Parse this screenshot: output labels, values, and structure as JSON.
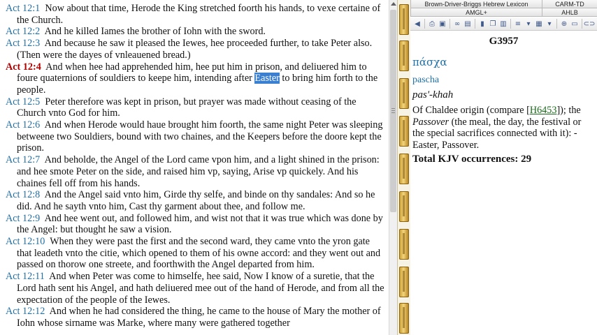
{
  "verses": [
    {
      "ref": "",
      "text": "Now about that time, Herode the King stretched foorth his hands, to vexe certaine of the Church."
    },
    {
      "ref": "Act 12:2",
      "text": "And he killed Iames the brother of Iohn with the sword."
    },
    {
      "ref": "Act 12:3",
      "text": "And because he saw it pleased the Iewes, hee proceeded further, to take Peter also. (Then were the dayes of vnleauened bread.)"
    },
    {
      "ref": "Act 12:4",
      "current": true,
      "text_before": "And when hee had apprehended him, hee put him in prison, and deliuered him to foure quaternions of souldiers to keepe him, intending after",
      "highlight": "Easter",
      "text_after": "to bring him forth to the people."
    },
    {
      "ref": "Act 12:5",
      "text": "Peter therefore was kept in prison, but prayer was made without ceasing of the Church vnto God for him."
    },
    {
      "ref": "Act 12:6",
      "text": "And when Herode would haue brought him foorth, the same night Peter was sleeping betweene two Souldiers, bound with two chaines, and the Keepers before the doore kept the prison."
    },
    {
      "ref": "Act 12:7",
      "text": "And beholde, the Angel of the Lord came vpon him, and a light shined in the prison: and hee smote Peter on the side, and raised him vp, saying, Arise vp quickely. And his chaines fell off from his hands."
    },
    {
      "ref": "Act 12:8",
      "text": "And the Angel said vnto him, Girde thy selfe, and binde on thy sandales: And so he did. And he sayth vnto him, Cast thy garment about thee, and follow me."
    },
    {
      "ref": "Act 12:9",
      "text": "And hee went out, and followed him, and wist not that it was true which was done by the Angel: but thought he saw a vision."
    },
    {
      "ref": "Act 12:10",
      "text": "When they were past the first and the second ward, they came vnto the yron gate that leadeth vnto the citie, which opened to them of his owne accord: and they went out and passed on thorow one streete, and foorthwith the Angel departed from him."
    },
    {
      "ref": "Act 12:11",
      "text": "And when Peter was come to himselfe, hee said, Now I know of a suretie, that the Lord hath sent his Angel, and hath deliuered mee out of the hand of Herode, and from all the expectation of the people of the Iewes."
    },
    {
      "ref": "Act 12:12",
      "text": "And when he had considered the thing, he came to the house of Mary the mother of Iohn whose sirname was Marke, where many were gathered together"
    }
  ],
  "first_ref": "Act 12:1",
  "lexicon": {
    "tabs_row1": [
      "Brown-Driver-Briggs Hebrew Lexicon",
      "CARM-TD"
    ],
    "tabs_row2": [
      "AMGL+",
      "AHLB"
    ],
    "strong_number": "G3957",
    "greek": "πάσχα",
    "transliteration": "pascha",
    "pronunciation": "pas'-khah",
    "def_prefix": "Of Chaldee origin (compare [",
    "def_link": "H6453",
    "def_mid": "]); the ",
    "def_italic": "Passover",
    "def_suffix": " (the meal, the day, the festival or the special sacrifices connected with it): - Easter, Passover.",
    "total_label": "Total KJV occurrences: 29"
  },
  "toolbar_icons": [
    "back-arrow-icon",
    "print-icon",
    "save-icon",
    "binoculars-icon",
    "search-doc-icon",
    "book-icon",
    "copy-icon",
    "paste-icon",
    "format-icon",
    "dropdown-icon",
    "grid-icon",
    "dropdown-icon",
    "zoom-icon",
    "panel-icon",
    "link-icon"
  ],
  "colors": {
    "reference": "#1f6fa6",
    "current_reference": "#b00000",
    "highlight": "#3a7fd0",
    "link": "#1a6a1a"
  }
}
